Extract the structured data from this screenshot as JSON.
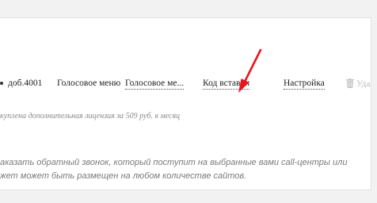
{
  "row": {
    "ext": "доб.4001",
    "type": "Голосовое меню",
    "name": "Голосовое ме...",
    "embed_code": "Код вставки",
    "settings": "Настройка",
    "delete": "Удал"
  },
  "note": "куплена дополнительная лицензия за 509 руб. в месяц",
  "description": {
    "line1": "аказать обратный звонок, который поступит на выбранные вами call-центры или",
    "line2": "жет может быть размещен на любом количестве сайтов."
  },
  "colors": {
    "arrow": "#e8141c",
    "background": "#f2f2f2",
    "panel": "#ffffff"
  },
  "icons": {
    "arrow": "red-arrow-annotation",
    "trash": "trash-icon"
  }
}
